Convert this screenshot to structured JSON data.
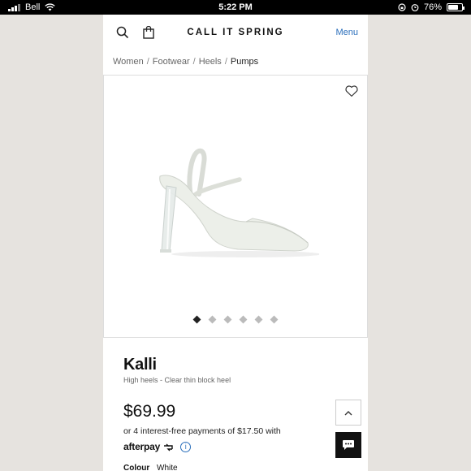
{
  "status_bar": {
    "carrier": "Bell",
    "time": "5:22 PM",
    "battery": "76%",
    "battery_level": 0.76
  },
  "header": {
    "brand": "CALL IT SPRING",
    "menu_label": "Menu"
  },
  "breadcrumb": [
    "Women",
    "Footwear",
    "Heels",
    "Pumps"
  ],
  "gallery": {
    "image_count": 6,
    "active_index": 0
  },
  "product": {
    "name": "Kalli",
    "subtitle": "High heels - Clear thin block heel",
    "price": "$69.99",
    "installments": "or 4 interest-free payments of $17.50 with",
    "afterpay": "afterpay",
    "colour_label": "Colour",
    "colour_value": "White"
  },
  "colors": {
    "accent": "#2a6ebb",
    "text": "#111111"
  }
}
